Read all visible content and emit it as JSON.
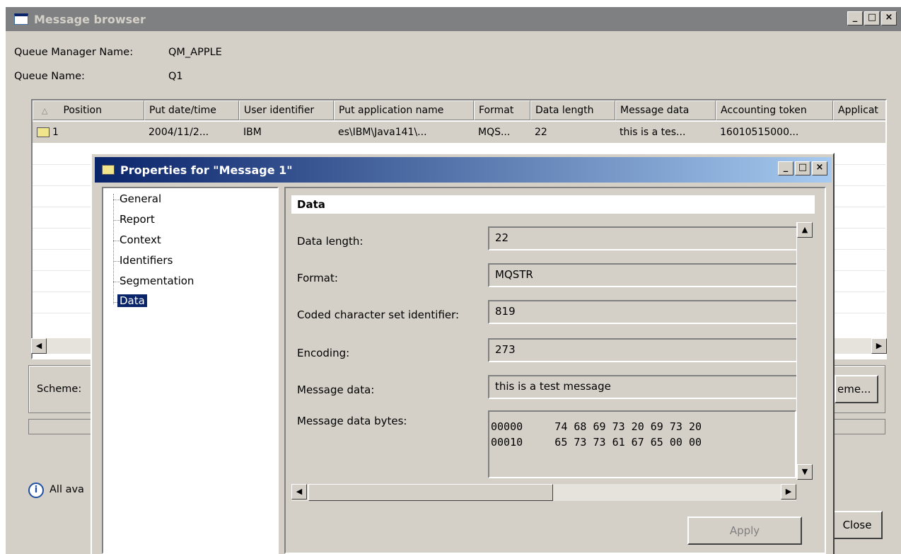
{
  "window": {
    "title": "Message browser",
    "controls": [
      "_",
      "□",
      "×"
    ]
  },
  "info": {
    "queue_manager_label": "Queue Manager Name:",
    "queue_manager_value": "QM_APPLE",
    "queue_label": "Queue Name:",
    "queue_value": "Q1"
  },
  "table": {
    "columns": [
      "Position",
      "Put date/time",
      "User identifier",
      "Put application name",
      "Format",
      "Data length",
      "Message data",
      "Accounting token",
      "Applicat"
    ],
    "rows": [
      [
        "1",
        "2004/11/2...",
        "IBM",
        "es\\IBM\\Java141\\...",
        "MQS...",
        "22",
        "this is a tes...",
        "16010515000..."
      ]
    ]
  },
  "scheme": {
    "label": "Scheme:",
    "button_partial": "eme..."
  },
  "status": {
    "text": "All ava"
  },
  "close_button": "Close",
  "dialog": {
    "title": "Properties for \"Message 1\"",
    "tree": [
      "General",
      "Report",
      "Context",
      "Identifiers",
      "Segmentation",
      "Data"
    ],
    "selected": "Data",
    "section_title": "Data",
    "fields": {
      "data_length_label": "Data length:",
      "data_length_value": "22",
      "format_label": "Format:",
      "format_value": "MQSTR",
      "ccsid_label": "Coded character set identifier:",
      "ccsid_value": "819",
      "encoding_label": "Encoding:",
      "encoding_value": "273",
      "message_data_label": "Message data:",
      "message_data_value": "this is a test message",
      "message_bytes_label": "Message data bytes:",
      "hex_lines": [
        "00000     74 68 69 73 20 69 73 20",
        "00010     65 73 73 61 67 65 00 00"
      ]
    },
    "apply_button": "Apply"
  }
}
